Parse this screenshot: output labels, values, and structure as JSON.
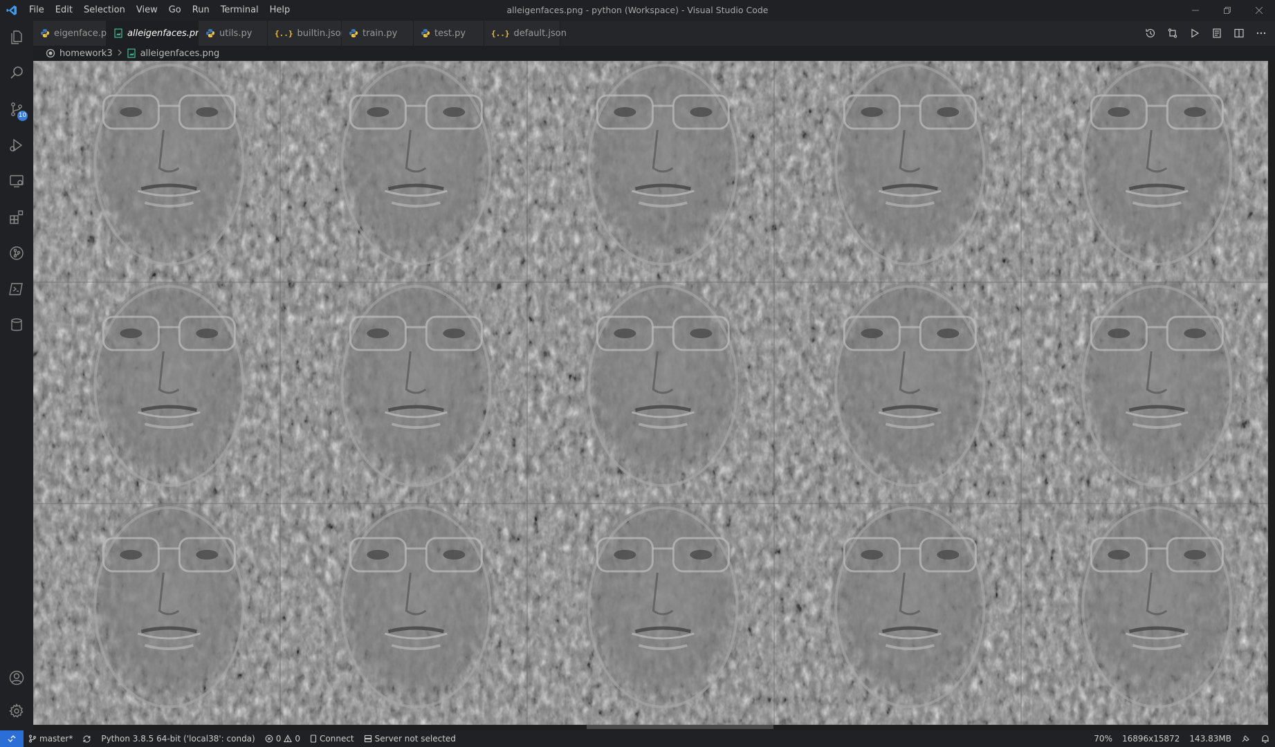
{
  "titlebar": {
    "menu": [
      "File",
      "Edit",
      "Selection",
      "View",
      "Go",
      "Run",
      "Terminal",
      "Help"
    ],
    "window_title": "alleigenfaces.png - python (Workspace) - Visual Studio Code"
  },
  "activity_bar": {
    "items": [
      "explorer-icon",
      "search-icon",
      "source-control-icon",
      "run-debug-icon",
      "remote-explorer-icon",
      "extensions-icon",
      "git-graph-icon",
      "terminal-icon",
      "database-icon"
    ],
    "source_control_badge": "10",
    "bottom": [
      "account-icon",
      "settings-gear-icon"
    ]
  },
  "tabs": [
    {
      "label": "eigenface.py",
      "icon": "python-icon"
    },
    {
      "label": "alleigenfaces.png",
      "icon": "image-icon",
      "active": true,
      "close": "×"
    },
    {
      "label": "utils.py",
      "icon": "python-icon"
    },
    {
      "label": "builtin.json",
      "icon": "json-icon"
    },
    {
      "label": "train.py",
      "icon": "python-icon"
    },
    {
      "label": "test.py",
      "icon": "python-icon"
    },
    {
      "label": "default.json",
      "icon": "json-icon"
    }
  ],
  "json_icon_text": "{..}",
  "breadcrumb": {
    "folder": "homework3",
    "file": "alleigenfaces.png"
  },
  "image": {
    "rows": 3,
    "cols": 5,
    "description_tiles": 15
  },
  "statusbar": {
    "branch": "master*",
    "interpreter": "Python 3.8.5 64-bit ('local38': conda)",
    "errors": "0",
    "warnings": "0",
    "connect": "Connect",
    "server": "Server not selected",
    "zoom": "70%",
    "dimensions": "16896x15872",
    "size": "143.83MB"
  },
  "colors": {
    "accent_blue": "#2b6fd6",
    "python_yellow": "#f2c744",
    "python_blue": "#3b77b5",
    "json_yellow": "#f1c232",
    "image_green": "#3fb68b"
  }
}
